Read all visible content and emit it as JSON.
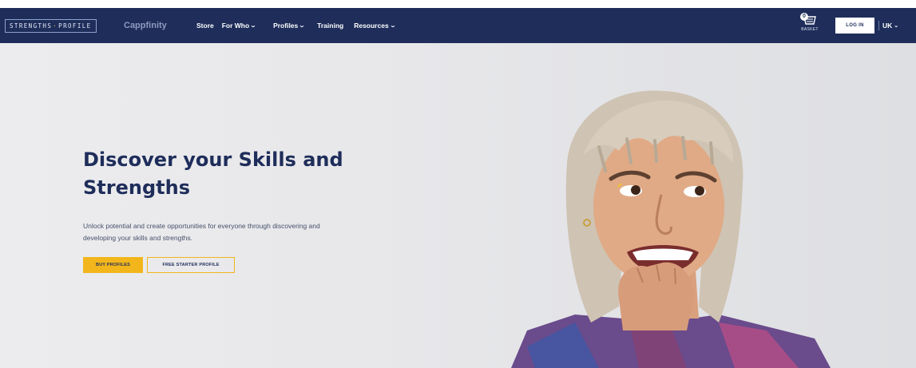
{
  "header": {
    "logo_left": "STRENGTHS",
    "logo_sep": "·",
    "logo_right": "PROFILE",
    "brand": "Cappfinity",
    "nav": [
      {
        "label": "Store",
        "has_dropdown": false
      },
      {
        "label": "For Who",
        "has_dropdown": true
      },
      {
        "label": "Profiles",
        "has_dropdown": true
      },
      {
        "label": "Training",
        "has_dropdown": false
      },
      {
        "label": "Resources",
        "has_dropdown": true
      }
    ],
    "basket": {
      "count": "0",
      "label": "BASKET",
      "icon": "basket-icon"
    },
    "login_label": "LOG IN",
    "locale_label": "UK"
  },
  "hero": {
    "title_line1": "Discover your Skills and",
    "title_line2": "Strengths",
    "lead_line1": "Unlock potential and create opportunities for everyone through discovering and",
    "lead_line2": "developing your skills and strengths.",
    "primary_label": "BUY PROFILES",
    "secondary_label": "FREE STARTER PROFILE"
  },
  "colors": {
    "navy": "#1e2d5a",
    "accent": "#f2b61c",
    "hero_bg": "#e7e7ea"
  }
}
